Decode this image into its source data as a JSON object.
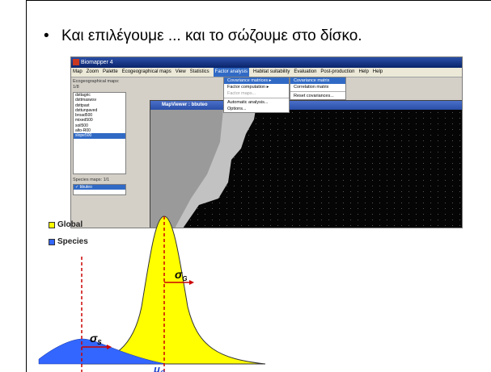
{
  "slide": {
    "bullet_symbol": "•",
    "bullet_text": "Και επιλέγουμε ... και το σώζουμε στο δίσκο."
  },
  "app": {
    "title": "Biomapper 4",
    "menu": [
      "Map",
      "Zoom",
      "Palette",
      "Ecogeographical maps",
      "View",
      "Statistics",
      "Factor analysis",
      "Habitat suitability",
      "Evaluation",
      "Post-production",
      "Help",
      "Help"
    ],
    "active_menu": "Factor analysis",
    "left_panel": {
      "eco_label": "Ecogeographical maps: 1/8",
      "eco_maps": [
        "dsttagric",
        "dsttmaswsv",
        "dsttpast",
        "dsttunpaved",
        "broad500",
        "mixed500",
        "soil500",
        "alto-R00",
        "slope500"
      ],
      "selected_eco": "slope500",
      "species_label": "Species maps: 1/1",
      "species_maps": [
        "bbuteo"
      ]
    },
    "factor_menu": {
      "items": [
        "Covariance matrices",
        "Factor computation",
        "Factor maps...",
        "Automatic analysis...",
        "Options..."
      ],
      "highlighted": "Covariance matrices"
    },
    "covariance_submenu": {
      "items": [
        "Covariance matrix",
        "Correlation matrix",
        "Reset covariances..."
      ],
      "highlighted": "Covariance matrix"
    },
    "mapviewer_title": "MapViewer : bbuteo"
  },
  "legend": {
    "global_label": "Global",
    "species_label": "Species",
    "global_color": "#ffff00",
    "species_color": "#3366ff"
  },
  "symbols": {
    "sigma_g": "σG",
    "sigma_s": "σS",
    "mu_g": "μG"
  },
  "colors": {
    "global_fill": "#ffff00",
    "species_fill": "#3366ff",
    "guide_line": "#cc0000",
    "sigma_arrow": "#cc0000"
  }
}
